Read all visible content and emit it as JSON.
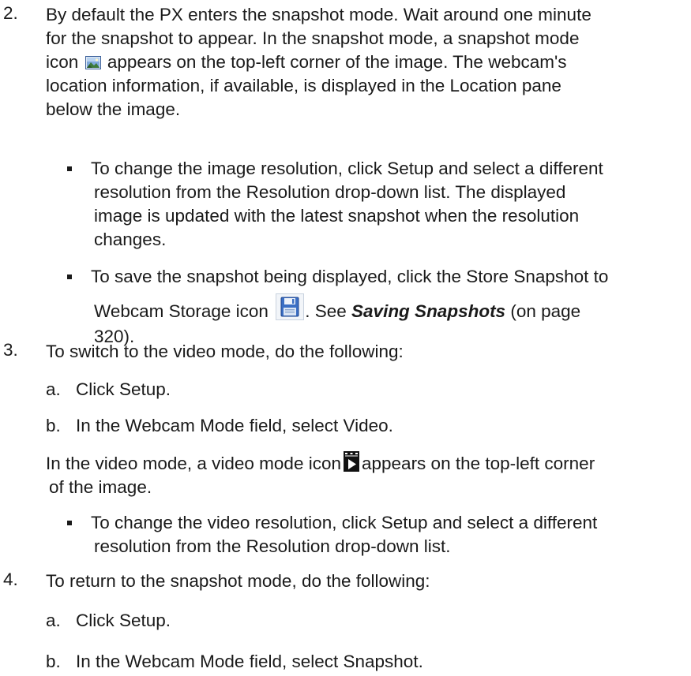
{
  "steps": [
    {
      "number": "2.",
      "lines": [
        "By default the PX enters the snapshot mode. Wait around one minute",
        "for the snapshot to appear. In the snapshot mode, a snapshot mode",
        "icon",
        "appears on the top-left corner of the image. The webcam's",
        "location information, if available, is displayed in the Location pane",
        "below the image."
      ],
      "bullets": [
        {
          "lines": [
            "To change the image resolution, click Setup and select a different",
            "resolution from the Resolution drop-down list. The displayed",
            "image is updated with the latest snapshot when the resolution",
            "changes."
          ]
        },
        {
          "line1": "To save the snapshot being displayed, click the Store Snapshot to",
          "line2_before": "Webcam Storage icon",
          "line2_after": ". See",
          "link": "Saving Snapshots",
          "line2_end": "(on page",
          "line3": "320)."
        }
      ]
    },
    {
      "number": "3.",
      "intro": "To switch to the video mode, do the following:",
      "substeps": [
        {
          "letter": "a.",
          "text": "Click Setup."
        },
        {
          "letter": "b.",
          "text": "In the Webcam Mode field, select Video."
        }
      ],
      "note_before": "In the video mode, a video mode icon",
      "note_after": "appears on the top-left corner",
      "note_line2": "of the image.",
      "bullet": {
        "lines": [
          "To change the video resolution, click Setup and select a different",
          "resolution from the Resolution drop-down list."
        ]
      }
    },
    {
      "number": "4.",
      "intro": "To return to the snapshot mode, do the following:",
      "substeps": [
        {
          "letter": "a.",
          "text": "Click Setup."
        },
        {
          "letter": "b.",
          "text": "In the Webcam Mode field, select Snapshot."
        }
      ]
    }
  ],
  "icons": {
    "snapshot_mode": "snapshot-mode-icon",
    "store_snapshot": "floppy-disk-icon",
    "video_mode": "video-mode-icon"
  },
  "colors": {
    "text": "#1a1a1a",
    "background": "#ffffff"
  }
}
